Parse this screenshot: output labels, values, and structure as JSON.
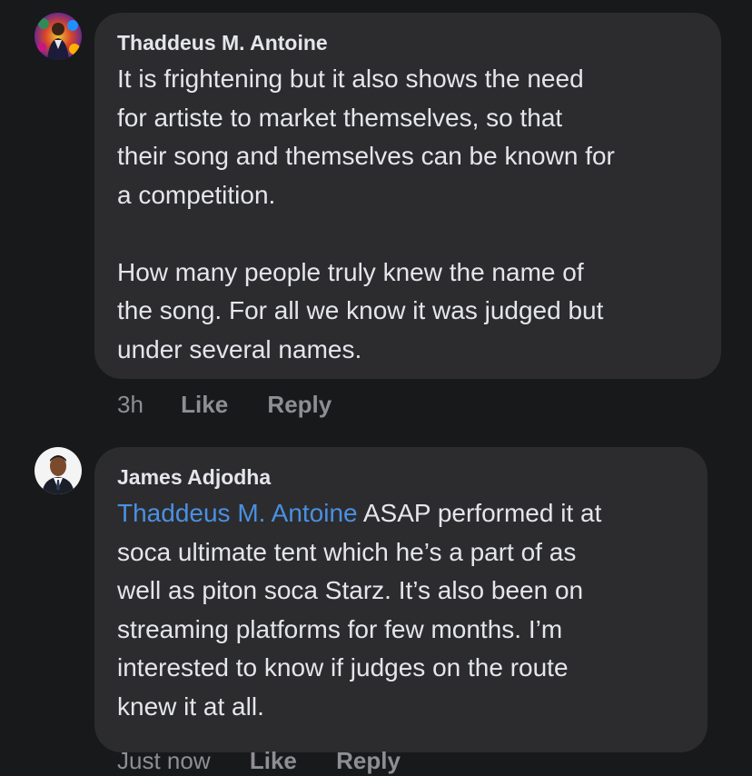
{
  "comments": [
    {
      "author": "Thaddeus M. Antoine",
      "lines1": [
        "It is frightening but it also shows the need",
        "for artiste to market themselves, so that",
        "their song and themselves can be known for",
        "a competition."
      ],
      "lines2": [
        "How many people truly knew the name of",
        "the song. For all we know it was judged but",
        "under several names."
      ],
      "time": "3h",
      "like_label": "Like",
      "reply_label": "Reply",
      "avatar_icon": "colorful-profile-photo"
    },
    {
      "author": "James Adjodha",
      "mention": "Thaddeus M. Antoine",
      "first_line_rest": " ASAP performed it at",
      "lines": [
        "soca ultimate tent which he’s a part of as",
        "well as piton soca Starz. It’s also been on",
        "streaming platforms for few months. I’m",
        "interested to know if judges on the route",
        "knew it at all."
      ],
      "time": "Just now",
      "like_label": "Like",
      "reply_label": "Reply",
      "avatar_icon": "man-in-suit-profile-photo"
    }
  ],
  "colors": {
    "background": "#18191b",
    "bubble": "#2c2c2e",
    "text": "#e4e6eb",
    "mention": "#4a90e2",
    "meta": "#8e8e93"
  }
}
